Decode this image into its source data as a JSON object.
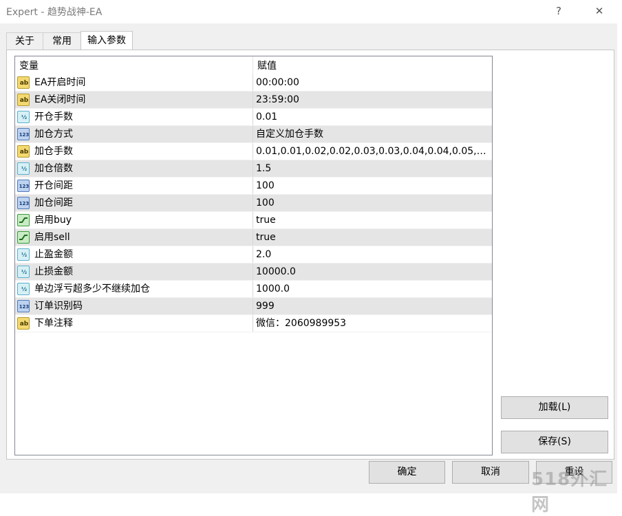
{
  "window": {
    "title": "Expert - 趋势战神-EA",
    "help_label": "?",
    "close_label": "✕"
  },
  "tabs": [
    {
      "label": "关于"
    },
    {
      "label": "常用"
    },
    {
      "label": "输入参数",
      "active": true
    }
  ],
  "grid": {
    "headers": {
      "variable": "变量",
      "value": "赋值"
    },
    "rows": [
      {
        "type": "string",
        "icon": "ab",
        "name": "EA开启时间",
        "value": "00:00:00"
      },
      {
        "type": "string",
        "icon": "ab",
        "name": "EA关闭时间",
        "value": "23:59:00"
      },
      {
        "type": "double",
        "icon": "½",
        "name": "开仓手数",
        "value": "0.01"
      },
      {
        "type": "integer",
        "icon": "123",
        "name": "加仓方式",
        "value": "自定义加仓手数"
      },
      {
        "type": "string",
        "icon": "ab",
        "name": "加仓手数",
        "value": "0.01,0.01,0.02,0.02,0.03,0.03,0.04,0.04,0.05,0..."
      },
      {
        "type": "double",
        "icon": "½",
        "name": "加仓倍数",
        "value": "1.5"
      },
      {
        "type": "integer",
        "icon": "123",
        "name": "开仓间距",
        "value": "100"
      },
      {
        "type": "integer",
        "icon": "123",
        "name": "加仓间距",
        "value": "100"
      },
      {
        "type": "bool",
        "icon": "toggle",
        "name": "启用buy",
        "value": "true"
      },
      {
        "type": "bool",
        "icon": "toggle",
        "name": "启用sell",
        "value": "true"
      },
      {
        "type": "double",
        "icon": "½",
        "name": "止盈金额",
        "value": "2.0"
      },
      {
        "type": "double",
        "icon": "½",
        "name": "止损金额",
        "value": "10000.0"
      },
      {
        "type": "double",
        "icon": "½",
        "name": "单边浮亏超多少不继续加仓",
        "value": "1000.0"
      },
      {
        "type": "integer",
        "icon": "123",
        "name": "订单识别码",
        "value": "999"
      },
      {
        "type": "string",
        "icon": "ab",
        "name": "下单注释",
        "value": "微信：2060989953"
      }
    ]
  },
  "buttons": {
    "load": "加载(L)",
    "save": "保存(S)",
    "ok": "确定",
    "cancel": "取消",
    "reset": "重设"
  },
  "watermark": "518外汇网"
}
